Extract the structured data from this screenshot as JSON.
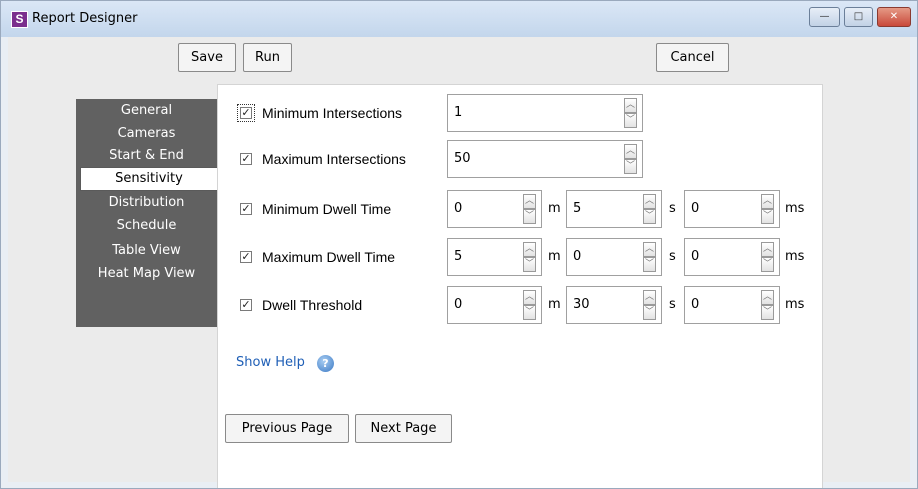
{
  "window": {
    "title": "Report Designer",
    "icon_letter": "S",
    "controls": {
      "minimize": "—",
      "maximize": "□",
      "close": "✕"
    }
  },
  "toolbar": {
    "save_label": "Save",
    "run_label": "Run",
    "cancel_label": "Cancel"
  },
  "sidebar": {
    "items": [
      {
        "label": "General"
      },
      {
        "label": "Cameras"
      },
      {
        "label": "Start & End"
      },
      {
        "label": "Sensitivity",
        "selected": true
      },
      {
        "label": "Distribution"
      },
      {
        "label": "Schedule"
      },
      {
        "label": "Table View"
      },
      {
        "label": "Heat Map View"
      }
    ]
  },
  "settings": [
    {
      "label": "Minimum Intersections",
      "checked": true,
      "fields": [
        {
          "value": "1"
        }
      ]
    },
    {
      "label": "Maximum Intersections",
      "checked": true,
      "fields": [
        {
          "value": "50"
        }
      ]
    },
    {
      "label": "Minimum Dwell Time",
      "checked": true,
      "fields": [
        {
          "value": "0",
          "unit": "m"
        },
        {
          "value": "5",
          "unit": "s"
        },
        {
          "value": "0",
          "unit": "ms"
        }
      ]
    },
    {
      "label": "Maximum Dwell Time",
      "checked": true,
      "fields": [
        {
          "value": "5",
          "unit": "m"
        },
        {
          "value": "0",
          "unit": "s"
        },
        {
          "value": "0",
          "unit": "ms"
        }
      ]
    },
    {
      "label": "Dwell Threshold",
      "checked": true,
      "fields": [
        {
          "value": "0",
          "unit": "m"
        },
        {
          "value": "30",
          "unit": "s"
        },
        {
          "value": "0",
          "unit": "ms"
        }
      ]
    }
  ],
  "glyphs": {
    "check": "✓",
    "spin_up": "︿",
    "spin_down": "﹀",
    "help": "?"
  },
  "help": {
    "label": "Show Help"
  },
  "nav": {
    "previous_label": "Previous Page",
    "next_label": "Next Page"
  }
}
